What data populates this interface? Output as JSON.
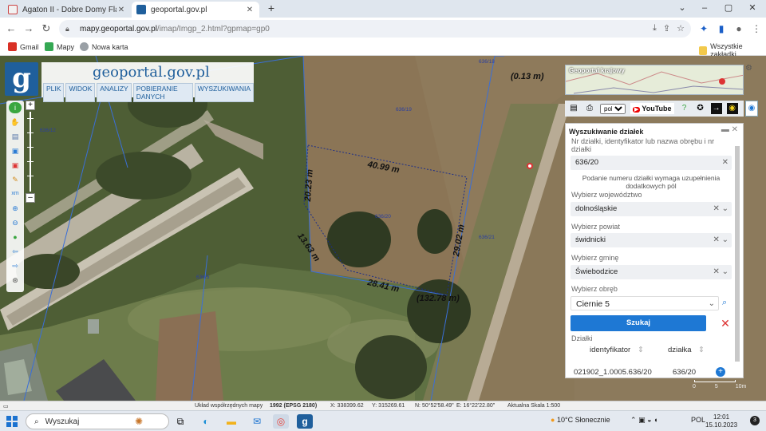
{
  "browser": {
    "tabs": [
      {
        "label": "Agaton II - Dobre Domy Flak & Ab"
      },
      {
        "label": "geoportal.gov.pl"
      }
    ],
    "url_host": "mapy.geoportal.gov.pl",
    "url_path": "/imap/Imgp_2.html?gpmap=gp0",
    "bookmarks": [
      {
        "label": "Gmail"
      },
      {
        "label": "Mapy"
      },
      {
        "label": "Nowa karta"
      }
    ],
    "all_bookmarks": "Wszystkie zakładki"
  },
  "app": {
    "logo_letter": "g",
    "brand_prefix": "geo",
    "brand_suffix": "portal.gov.pl",
    "menu": [
      "PLIK",
      "WIDOK",
      "ANALIZY",
      "POBIERANIE DANYCH",
      "WYSZUKIWANIA"
    ]
  },
  "map": {
    "measurements": [
      "(0.13 m)",
      "40.99 m",
      "20.23 m",
      "13.63 m",
      "28.41 m",
      "(132.78 m)",
      "29.02 m"
    ],
    "parcels": [
      "636/18",
      "636/19",
      "636/12",
      "636/20",
      "636/21",
      "636/5"
    ]
  },
  "minimap": {
    "title": "Geoportal krajowy"
  },
  "toolrow": {
    "lang": "pol",
    "youtube": "YouTube"
  },
  "search": {
    "title": "Wyszukiwanie działek",
    "f1_label": "Nr działki, identyfikator lub nazwa obrębu i nr działki",
    "f1_value": "636/20",
    "note": "Podanie numeru działki wymaga uzupełnienia dodatkowych pól",
    "woj_label": "Wybierz województwo",
    "woj_value": "dolnośląskie",
    "pow_label": "Wybierz powiat",
    "pow_value": "świdnicki",
    "gm_label": "Wybierz gminę",
    "gm_value": "Świebodzice",
    "ob_label": "Wybierz obręb",
    "ob_value": "Ciernie 5",
    "btn": "Szukaj",
    "results_label": "Działki",
    "col_id": "identyfikator",
    "col_dz": "działka",
    "row_id": "021902_1.0005.636/20",
    "row_dz": "636/20"
  },
  "scale": {
    "left": "0",
    "mid": "5",
    "right": "10m"
  },
  "status": {
    "crs_prefix": "Układ współrzędnych mapy",
    "crs": "1992 (EPSG 2180)",
    "x": "X: 338399.62",
    "y": "Y: 315269.61",
    "n": "N: 50°52'58.49\"",
    "e": "E: 16°22'22.80\"",
    "scale": "Aktualna Skala 1:500"
  },
  "taskbar": {
    "search": "Wyszukaj",
    "weather": "10°C  Słonecznie",
    "lang": "POL",
    "time": "12:01",
    "date": "15.10.2023"
  }
}
